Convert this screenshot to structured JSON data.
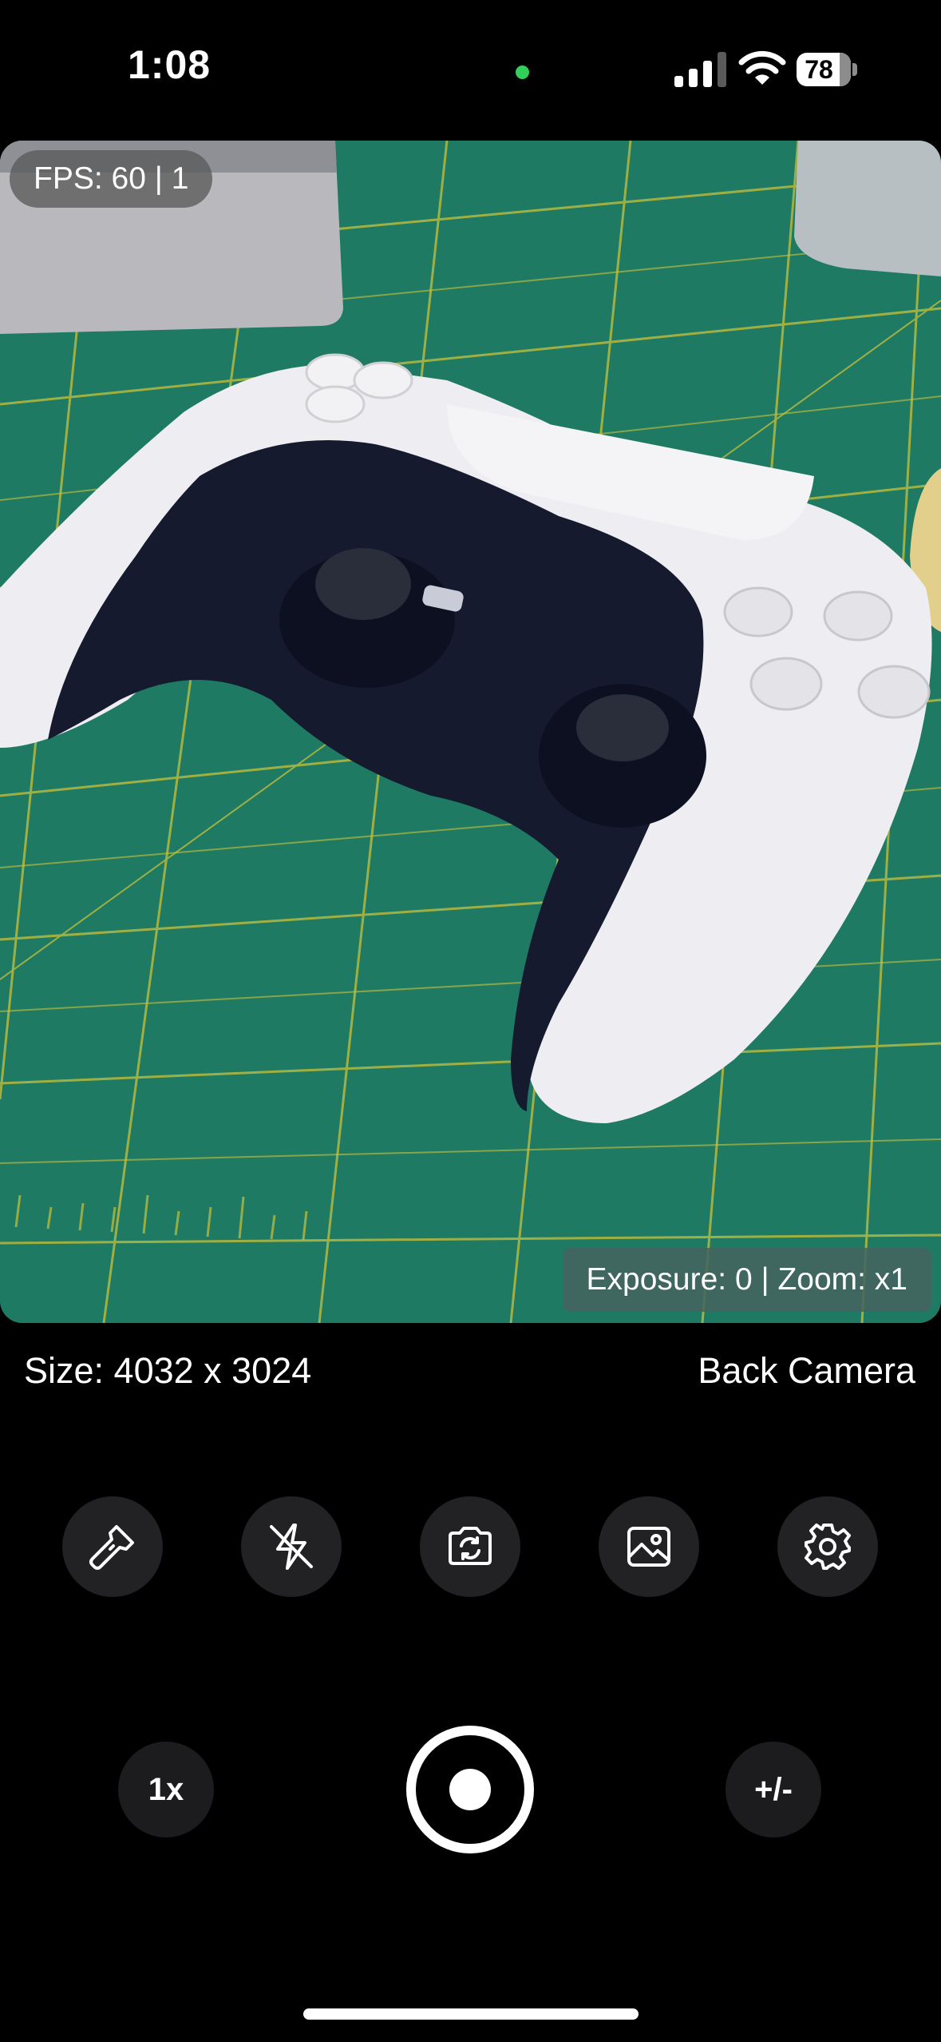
{
  "status_bar": {
    "time": "1:08",
    "battery_percent": "78",
    "privacy_dot_color": "#2fd158"
  },
  "preview": {
    "fps_label": "FPS: 60 | 1",
    "exposure_label": "Exposure: 0 | Zoom: x1",
    "mat_color": "#1e7a63",
    "grid_color": "#c9c23a"
  },
  "info": {
    "size_label": "Size: 4032 x 3024",
    "camera_label": "Back Camera"
  },
  "toolbar": {
    "buttons": [
      {
        "name": "torch",
        "icon": "flashlight-icon"
      },
      {
        "name": "flash",
        "icon": "flash-off-icon"
      },
      {
        "name": "switch-camera",
        "icon": "camera-switch-icon"
      },
      {
        "name": "gallery",
        "icon": "image-icon"
      },
      {
        "name": "settings",
        "icon": "gear-icon"
      }
    ]
  },
  "controls": {
    "zoom_label": "1x",
    "exposure_toggle_label": "+/-"
  }
}
